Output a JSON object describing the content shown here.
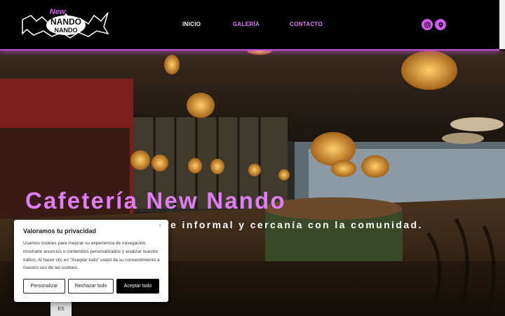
{
  "header": {
    "logo_alt": "New Nando",
    "nav": [
      {
        "label": "INICIO"
      },
      {
        "label": "GALERÍA"
      },
      {
        "label": "CONTACTO"
      }
    ],
    "social": [
      {
        "icon": "instagram-icon"
      },
      {
        "icon": "location-pin-icon"
      }
    ]
  },
  "hero": {
    "title": "Cafetería New Nando",
    "subtitle": "te informal y cercanía con la comunidad."
  },
  "cookie": {
    "title": "Valoramos tu privacidad",
    "close": "×",
    "text": "Usamos cookies para mejorar su experiencia de navegación, mostrarle anuncios o contenidos personalizados y analizar nuestro tráfico. Al hacer clic en \"Aceptar todo\" usted da su consentimiento a nuestro uso de las cookies.",
    "buttons": {
      "customize": "Personalizar",
      "reject": "Rechazar todo",
      "accept": "Aceptar todo"
    }
  },
  "language": {
    "label": "ES"
  },
  "colors": {
    "accent": "#e07cf5",
    "header_bg": "#000000"
  }
}
